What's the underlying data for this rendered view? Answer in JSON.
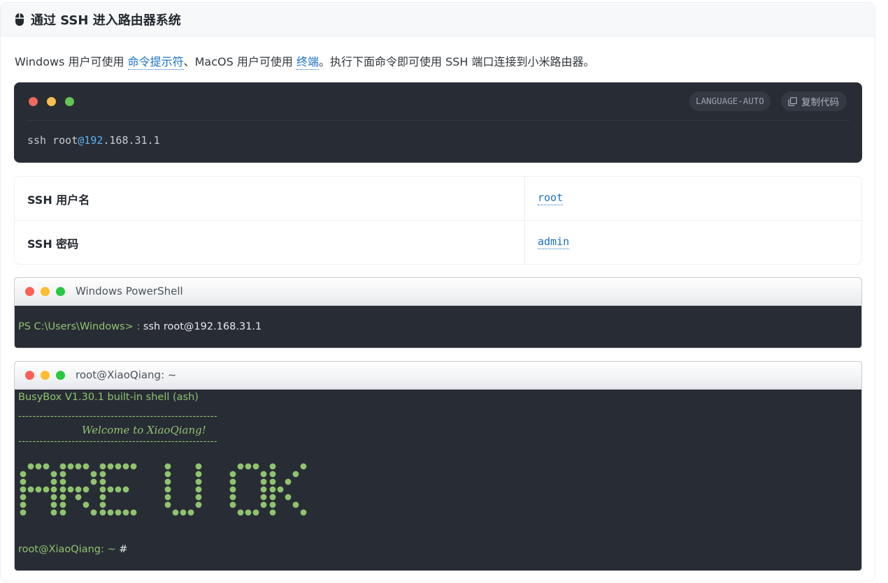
{
  "header": {
    "icon": "mouse-icon",
    "title": "通过 SSH 进入路由器系统"
  },
  "intro": {
    "part1": "Windows 用户可使用 ",
    "link_cmd": "命令提示符",
    "part2": "、MacOS 用户可使用 ",
    "link_terminal": "终端",
    "part3": "。执行下面命令即可使用 SSH 端口连接到小米路由器。"
  },
  "code_block": {
    "language": "LANGUAGE-AUTO",
    "copy_label": "复制代码",
    "copy_icon": "copy-icon",
    "cmd_pre": "ssh root",
    "cmd_at_ip": "@192",
    "cmd_post": ".168.31.1",
    "colors": {
      "red": "#ed6a5e",
      "yellow": "#f5bf4f",
      "green": "#62c554"
    }
  },
  "credentials": [
    {
      "label": "SSH 用户名",
      "value": "root"
    },
    {
      "label": "SSH 密码",
      "value": "admin"
    }
  ],
  "powershell": {
    "title": "Windows PowerShell",
    "prompt": "PS C:\\Users\\Windows> : ",
    "command": "ssh root@192.168.31.1"
  },
  "xiaoqiang": {
    "title": "root@XiaoQiang: ~",
    "busybox": "BusyBox V1.30.1 built-in shell (ash)",
    "dashes": "--------------------------------------------------------",
    "welcome": "Welcome to XiaoQiang!",
    "banner_text": "ARE U OK",
    "prompt": "root@XiaoQiang: ~ ",
    "cursor": "#"
  },
  "window_dot_colors": {
    "red": "#ff5f57",
    "yellow": "#febc2e",
    "green": "#28c840"
  },
  "terminal_green": "#8fc370"
}
